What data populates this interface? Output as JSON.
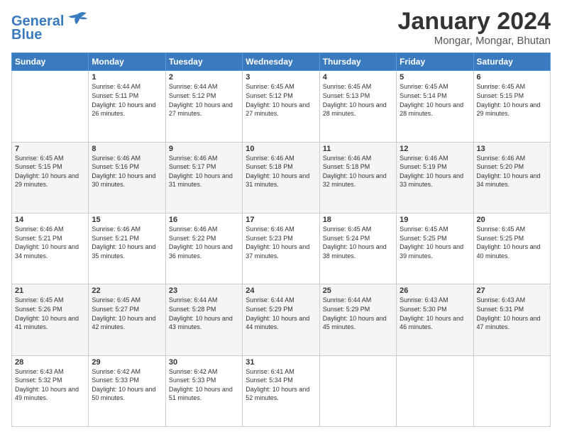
{
  "header": {
    "logo_line1": "General",
    "logo_line2": "Blue",
    "title": "January 2024",
    "subtitle": "Mongar, Mongar, Bhutan"
  },
  "weekdays": [
    "Sunday",
    "Monday",
    "Tuesday",
    "Wednesday",
    "Thursday",
    "Friday",
    "Saturday"
  ],
  "rows": [
    [
      {
        "num": "",
        "sunrise": "",
        "sunset": "",
        "daylight": ""
      },
      {
        "num": "1",
        "sunrise": "Sunrise: 6:44 AM",
        "sunset": "Sunset: 5:11 PM",
        "daylight": "Daylight: 10 hours and 26 minutes."
      },
      {
        "num": "2",
        "sunrise": "Sunrise: 6:44 AM",
        "sunset": "Sunset: 5:12 PM",
        "daylight": "Daylight: 10 hours and 27 minutes."
      },
      {
        "num": "3",
        "sunrise": "Sunrise: 6:45 AM",
        "sunset": "Sunset: 5:12 PM",
        "daylight": "Daylight: 10 hours and 27 minutes."
      },
      {
        "num": "4",
        "sunrise": "Sunrise: 6:45 AM",
        "sunset": "Sunset: 5:13 PM",
        "daylight": "Daylight: 10 hours and 28 minutes."
      },
      {
        "num": "5",
        "sunrise": "Sunrise: 6:45 AM",
        "sunset": "Sunset: 5:14 PM",
        "daylight": "Daylight: 10 hours and 28 minutes."
      },
      {
        "num": "6",
        "sunrise": "Sunrise: 6:45 AM",
        "sunset": "Sunset: 5:15 PM",
        "daylight": "Daylight: 10 hours and 29 minutes."
      }
    ],
    [
      {
        "num": "7",
        "sunrise": "Sunrise: 6:45 AM",
        "sunset": "Sunset: 5:15 PM",
        "daylight": "Daylight: 10 hours and 29 minutes."
      },
      {
        "num": "8",
        "sunrise": "Sunrise: 6:46 AM",
        "sunset": "Sunset: 5:16 PM",
        "daylight": "Daylight: 10 hours and 30 minutes."
      },
      {
        "num": "9",
        "sunrise": "Sunrise: 6:46 AM",
        "sunset": "Sunset: 5:17 PM",
        "daylight": "Daylight: 10 hours and 31 minutes."
      },
      {
        "num": "10",
        "sunrise": "Sunrise: 6:46 AM",
        "sunset": "Sunset: 5:18 PM",
        "daylight": "Daylight: 10 hours and 31 minutes."
      },
      {
        "num": "11",
        "sunrise": "Sunrise: 6:46 AM",
        "sunset": "Sunset: 5:18 PM",
        "daylight": "Daylight: 10 hours and 32 minutes."
      },
      {
        "num": "12",
        "sunrise": "Sunrise: 6:46 AM",
        "sunset": "Sunset: 5:19 PM",
        "daylight": "Daylight: 10 hours and 33 minutes."
      },
      {
        "num": "13",
        "sunrise": "Sunrise: 6:46 AM",
        "sunset": "Sunset: 5:20 PM",
        "daylight": "Daylight: 10 hours and 34 minutes."
      }
    ],
    [
      {
        "num": "14",
        "sunrise": "Sunrise: 6:46 AM",
        "sunset": "Sunset: 5:21 PM",
        "daylight": "Daylight: 10 hours and 34 minutes."
      },
      {
        "num": "15",
        "sunrise": "Sunrise: 6:46 AM",
        "sunset": "Sunset: 5:21 PM",
        "daylight": "Daylight: 10 hours and 35 minutes."
      },
      {
        "num": "16",
        "sunrise": "Sunrise: 6:46 AM",
        "sunset": "Sunset: 5:22 PM",
        "daylight": "Daylight: 10 hours and 36 minutes."
      },
      {
        "num": "17",
        "sunrise": "Sunrise: 6:46 AM",
        "sunset": "Sunset: 5:23 PM",
        "daylight": "Daylight: 10 hours and 37 minutes."
      },
      {
        "num": "18",
        "sunrise": "Sunrise: 6:45 AM",
        "sunset": "Sunset: 5:24 PM",
        "daylight": "Daylight: 10 hours and 38 minutes."
      },
      {
        "num": "19",
        "sunrise": "Sunrise: 6:45 AM",
        "sunset": "Sunset: 5:25 PM",
        "daylight": "Daylight: 10 hours and 39 minutes."
      },
      {
        "num": "20",
        "sunrise": "Sunrise: 6:45 AM",
        "sunset": "Sunset: 5:25 PM",
        "daylight": "Daylight: 10 hours and 40 minutes."
      }
    ],
    [
      {
        "num": "21",
        "sunrise": "Sunrise: 6:45 AM",
        "sunset": "Sunset: 5:26 PM",
        "daylight": "Daylight: 10 hours and 41 minutes."
      },
      {
        "num": "22",
        "sunrise": "Sunrise: 6:45 AM",
        "sunset": "Sunset: 5:27 PM",
        "daylight": "Daylight: 10 hours and 42 minutes."
      },
      {
        "num": "23",
        "sunrise": "Sunrise: 6:44 AM",
        "sunset": "Sunset: 5:28 PM",
        "daylight": "Daylight: 10 hours and 43 minutes."
      },
      {
        "num": "24",
        "sunrise": "Sunrise: 6:44 AM",
        "sunset": "Sunset: 5:29 PM",
        "daylight": "Daylight: 10 hours and 44 minutes."
      },
      {
        "num": "25",
        "sunrise": "Sunrise: 6:44 AM",
        "sunset": "Sunset: 5:29 PM",
        "daylight": "Daylight: 10 hours and 45 minutes."
      },
      {
        "num": "26",
        "sunrise": "Sunrise: 6:43 AM",
        "sunset": "Sunset: 5:30 PM",
        "daylight": "Daylight: 10 hours and 46 minutes."
      },
      {
        "num": "27",
        "sunrise": "Sunrise: 6:43 AM",
        "sunset": "Sunset: 5:31 PM",
        "daylight": "Daylight: 10 hours and 47 minutes."
      }
    ],
    [
      {
        "num": "28",
        "sunrise": "Sunrise: 6:43 AM",
        "sunset": "Sunset: 5:32 PM",
        "daylight": "Daylight: 10 hours and 49 minutes."
      },
      {
        "num": "29",
        "sunrise": "Sunrise: 6:42 AM",
        "sunset": "Sunset: 5:33 PM",
        "daylight": "Daylight: 10 hours and 50 minutes."
      },
      {
        "num": "30",
        "sunrise": "Sunrise: 6:42 AM",
        "sunset": "Sunset: 5:33 PM",
        "daylight": "Daylight: 10 hours and 51 minutes."
      },
      {
        "num": "31",
        "sunrise": "Sunrise: 6:41 AM",
        "sunset": "Sunset: 5:34 PM",
        "daylight": "Daylight: 10 hours and 52 minutes."
      },
      {
        "num": "",
        "sunrise": "",
        "sunset": "",
        "daylight": ""
      },
      {
        "num": "",
        "sunrise": "",
        "sunset": "",
        "daylight": ""
      },
      {
        "num": "",
        "sunrise": "",
        "sunset": "",
        "daylight": ""
      }
    ]
  ]
}
